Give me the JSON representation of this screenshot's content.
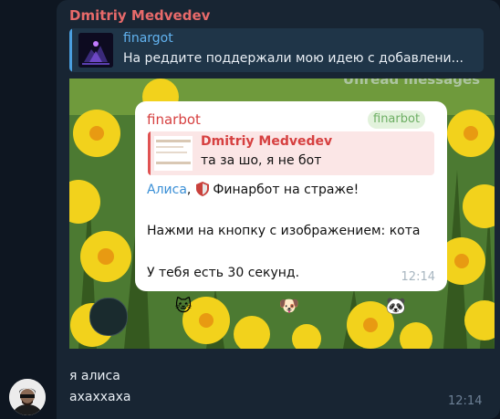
{
  "message": {
    "sender": "Dmitriy Medvedev",
    "reply": {
      "title": "finargot",
      "text": "На реддите поддержали мою идею с добавлени..."
    },
    "photo": {
      "unread_label": "Unread messages",
      "card": {
        "bot_name": "finarbot",
        "badge": "finarbot",
        "reply": {
          "name": "Dmitriy Medvedev",
          "text": "та за шо, я не бот"
        },
        "mention": "Алиса",
        "comma": ",",
        "headline": "Финарбот на страже!",
        "prompt": "Нажми на кнопку с изображением: кота",
        "timer": "У тебя есть 30 секунд.",
        "time": "12:14"
      },
      "keyboard": [
        {
          "emoji": "🐱",
          "icon": "cat-emoji"
        },
        {
          "emoji": "🐶",
          "icon": "dog-emoji"
        },
        {
          "emoji": "🐼",
          "icon": "panda-emoji"
        }
      ]
    },
    "caption_lines": [
      "я алиса",
      "ахаххаха"
    ],
    "time": "12:14"
  },
  "colors": {
    "background": "#0e1621",
    "bubble": "#182533",
    "sender_name": "#e86a6a",
    "link": "#62b3f0"
  }
}
